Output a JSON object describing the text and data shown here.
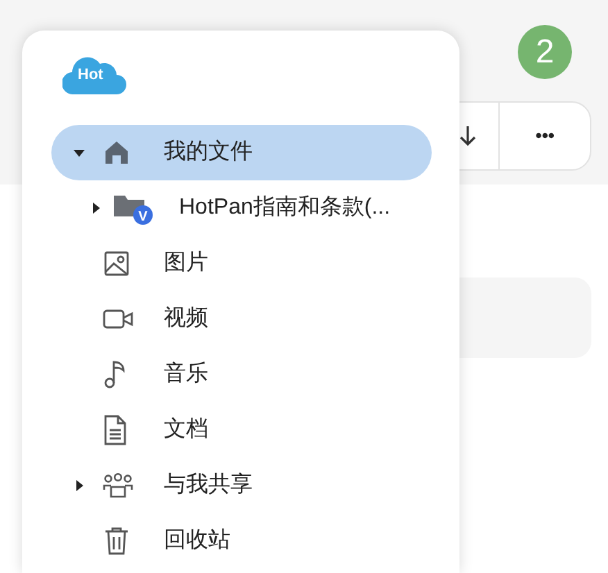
{
  "badge": "2",
  "toolbar": {
    "buttons": [
      {
        "kind": "download"
      },
      {
        "kind": "more",
        "label": "•••"
      }
    ]
  },
  "drawer": {
    "logo": "Hot",
    "items": [
      {
        "kind": "home",
        "label": "我的文件",
        "selected": true,
        "expanded": true,
        "children": [
          {
            "kind": "shared-folder",
            "label": "HotPan指南和条款(...",
            "selected": false,
            "expanded": false,
            "badge": "V"
          }
        ]
      },
      {
        "kind": "image",
        "label": "图片",
        "selected": false
      },
      {
        "kind": "video",
        "label": "视频",
        "selected": false
      },
      {
        "kind": "music",
        "label": "音乐",
        "selected": false
      },
      {
        "kind": "document",
        "label": "文档",
        "selected": false
      },
      {
        "kind": "people",
        "label": "与我共享",
        "selected": false,
        "expanded": false
      },
      {
        "kind": "trash",
        "label": "回收站",
        "selected": false
      }
    ]
  }
}
